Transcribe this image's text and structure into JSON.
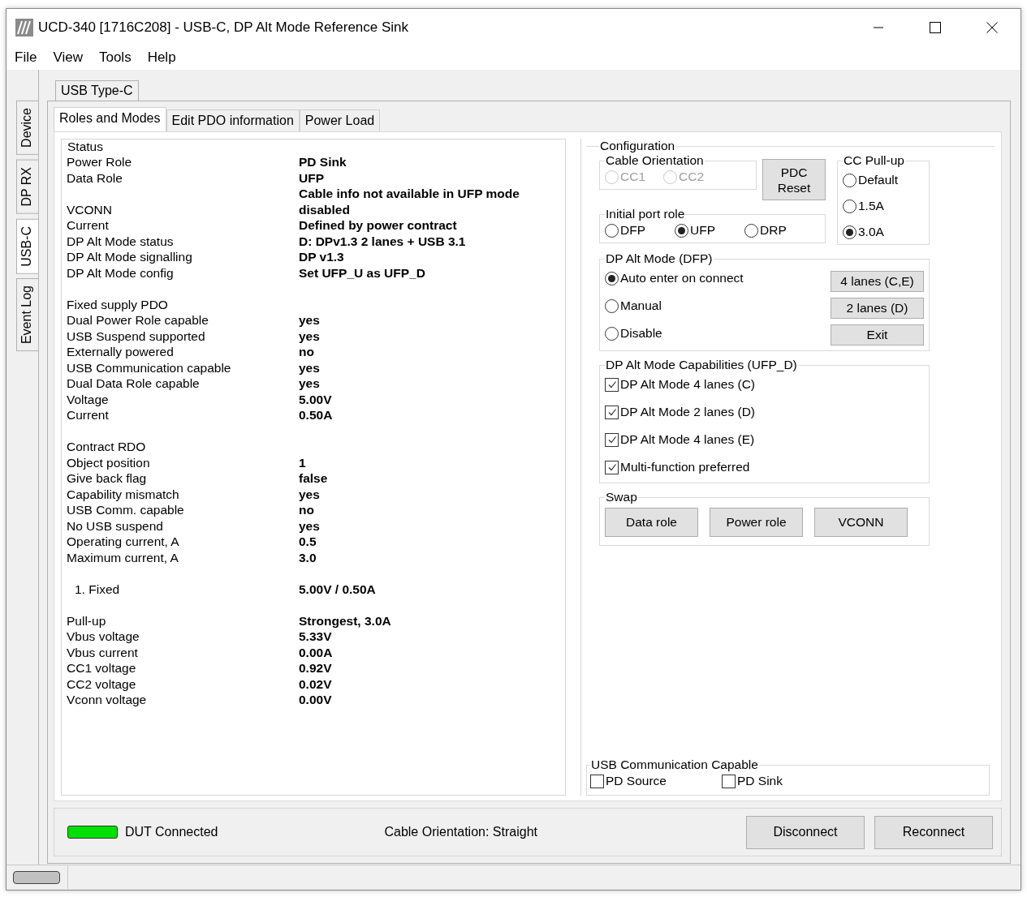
{
  "window": {
    "title": "UCD-340 [1716C208] - USB-C, DP Alt Mode Reference Sink"
  },
  "menu": [
    "File",
    "View",
    "Tools",
    "Help"
  ],
  "side_tabs": [
    {
      "label": "Device",
      "selected": false
    },
    {
      "label": "DP RX",
      "selected": false
    },
    {
      "label": "USB-C",
      "selected": true
    },
    {
      "label": "Event Log",
      "selected": false
    }
  ],
  "outer_tab": {
    "label": "USB Type-C"
  },
  "tabs": [
    {
      "label": "Roles and Modes",
      "selected": true
    },
    {
      "label": "Edit PDO information",
      "selected": false
    },
    {
      "label": "Power Load",
      "selected": false
    }
  ],
  "status": {
    "title": "Status",
    "sections": [
      {
        "kind": "fields",
        "rows": [
          {
            "label": "Power Role",
            "value": "PD Sink"
          },
          {
            "label": "Data Role",
            "value": "UFP"
          },
          {
            "value": "Cable info not available in UFP mode"
          },
          {
            "label": "VCONN",
            "value": "disabled"
          },
          {
            "label": "Current",
            "value": "Defined by power contract"
          },
          {
            "label": "DP Alt Mode status",
            "value": "D: DPv1.3 2 lanes + USB 3.1"
          },
          {
            "label": "DP Alt Mode signalling",
            "value": "DP v1.3"
          },
          {
            "label": "DP Alt Mode config",
            "value": "Set UFP_U as UFP_D"
          }
        ]
      },
      {
        "kind": "fields",
        "rows": [
          {
            "label": "Fixed supply PDO"
          },
          {
            "label": "Dual Power Role capable",
            "value": "yes"
          },
          {
            "label": "USB Suspend supported",
            "value": "yes"
          },
          {
            "label": "Externally powered",
            "value": "no"
          },
          {
            "label": "USB Communication capable",
            "value": "yes"
          },
          {
            "label": "Dual Data Role capable",
            "value": "yes"
          },
          {
            "label": "Voltage",
            "value": "5.00V"
          },
          {
            "label": "Current",
            "value": "0.50A"
          }
        ]
      },
      {
        "kind": "fields",
        "rows": [
          {
            "label": "Contract RDO"
          },
          {
            "label": "Object position",
            "value": "1"
          },
          {
            "label": "Give back flag",
            "value": "false"
          },
          {
            "label": "Capability mismatch",
            "value": "yes"
          },
          {
            "label": "USB Comm. capable",
            "value": "no"
          },
          {
            "label": "No USB suspend",
            "value": "yes"
          },
          {
            "label": "Operating current, A",
            "value": "0.5"
          },
          {
            "label": "Maximum current, A",
            "value": "3.0"
          }
        ]
      },
      {
        "kind": "list",
        "rows": [
          {
            "label": "1. Fixed",
            "value": "5.00V / 0.50A"
          }
        ]
      },
      {
        "kind": "fields",
        "rows": [
          {
            "label": "Pull-up",
            "value": "Strongest, 3.0A"
          },
          {
            "label": "Vbus voltage",
            "value": "5.33V"
          },
          {
            "label": "Vbus current",
            "value": "0.00A"
          },
          {
            "label": "CC1 voltage",
            "value": "0.92V"
          },
          {
            "label": "CC2 voltage",
            "value": "0.02V"
          },
          {
            "label": "Vconn voltage",
            "value": "0.00V"
          }
        ]
      }
    ]
  },
  "configuration": {
    "title": "Configuration",
    "cable_orientation": {
      "title": "Cable Orientation",
      "options": [
        {
          "label": "CC1",
          "selected": false,
          "disabled": true
        },
        {
          "label": "CC2",
          "selected": false,
          "disabled": true
        }
      ]
    },
    "pdc_reset": "PDC Reset",
    "initial_port_role": {
      "title": "Initial port role",
      "options": [
        {
          "label": "DFP",
          "selected": false,
          "disabled": false
        },
        {
          "label": "UFP",
          "selected": true,
          "disabled": false
        },
        {
          "label": "DRP",
          "selected": false,
          "disabled": false
        }
      ]
    },
    "cc_pullup": {
      "title": "CC Pull-up",
      "options": [
        {
          "label": "Default",
          "selected": false,
          "disabled": false
        },
        {
          "label": "1.5A",
          "selected": false,
          "disabled": false
        },
        {
          "label": "3.0A",
          "selected": true,
          "disabled": false
        }
      ]
    },
    "dp_alt_mode": {
      "title": "DP Alt Mode (DFP)",
      "options": [
        {
          "label": "Auto enter on connect",
          "selected": true,
          "disabled": false
        },
        {
          "label": "Manual",
          "selected": false,
          "disabled": false
        },
        {
          "label": "Disable",
          "selected": false,
          "disabled": false
        }
      ],
      "buttons": [
        "4 lanes (C,E)",
        "2 lanes (D)",
        "Exit"
      ]
    },
    "capabilities": {
      "title": "DP Alt Mode Capabilities (UFP_D)",
      "items": [
        {
          "label": "DP Alt Mode 4 lanes (C)",
          "checked": true
        },
        {
          "label": "DP Alt Mode 2 lanes (D)",
          "checked": true
        },
        {
          "label": "DP Alt Mode 4 lanes (E)",
          "checked": true
        },
        {
          "label": "Multi-function preferred",
          "checked": true
        }
      ]
    },
    "swap": {
      "title": "Swap",
      "buttons": [
        "Data role",
        "Power role",
        "VCONN"
      ]
    }
  },
  "usb_comm": {
    "title": "USB Communication Capable",
    "items": [
      {
        "label": "PD Source",
        "checked": false
      },
      {
        "label": "PD Sink",
        "checked": false
      }
    ]
  },
  "bottom": {
    "connected": true,
    "status": "DUT Connected",
    "cable": "Cable Orientation: Straight",
    "buttons": [
      "Disconnect",
      "Reconnect"
    ]
  }
}
